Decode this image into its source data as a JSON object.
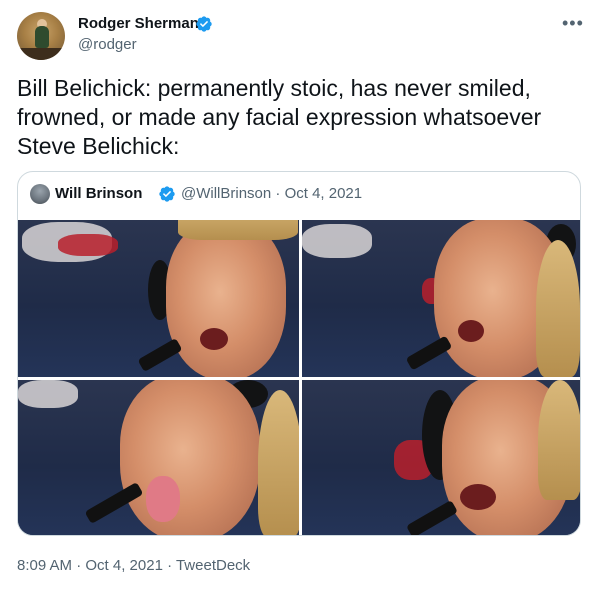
{
  "author": {
    "name": "Rodger Sherman",
    "handle": "@rodger"
  },
  "tweet": {
    "lines": [
      "Bill Belichick: permanently stoic, has never smiled,",
      "frowned, or made any facial expression whatsoever",
      "Steve Belichick:"
    ]
  },
  "quoted": {
    "name": "Will Brinson",
    "meta": "@WillBrinson · Oct 4, 2021",
    "images": [
      {
        "label": "photo-1"
      },
      {
        "label": "photo-2"
      },
      {
        "label": "photo-3"
      },
      {
        "label": "photo-4"
      }
    ]
  },
  "footer": {
    "text": "8:09 AM · Oct 4, 2021 · TweetDeck"
  },
  "icons": {
    "verified": "verified-badge-icon",
    "more": "more-options-icon"
  },
  "colors": {
    "verified_blue": "#1d9bf0",
    "secondary_text": "#536471",
    "border": "#cfd9de"
  }
}
